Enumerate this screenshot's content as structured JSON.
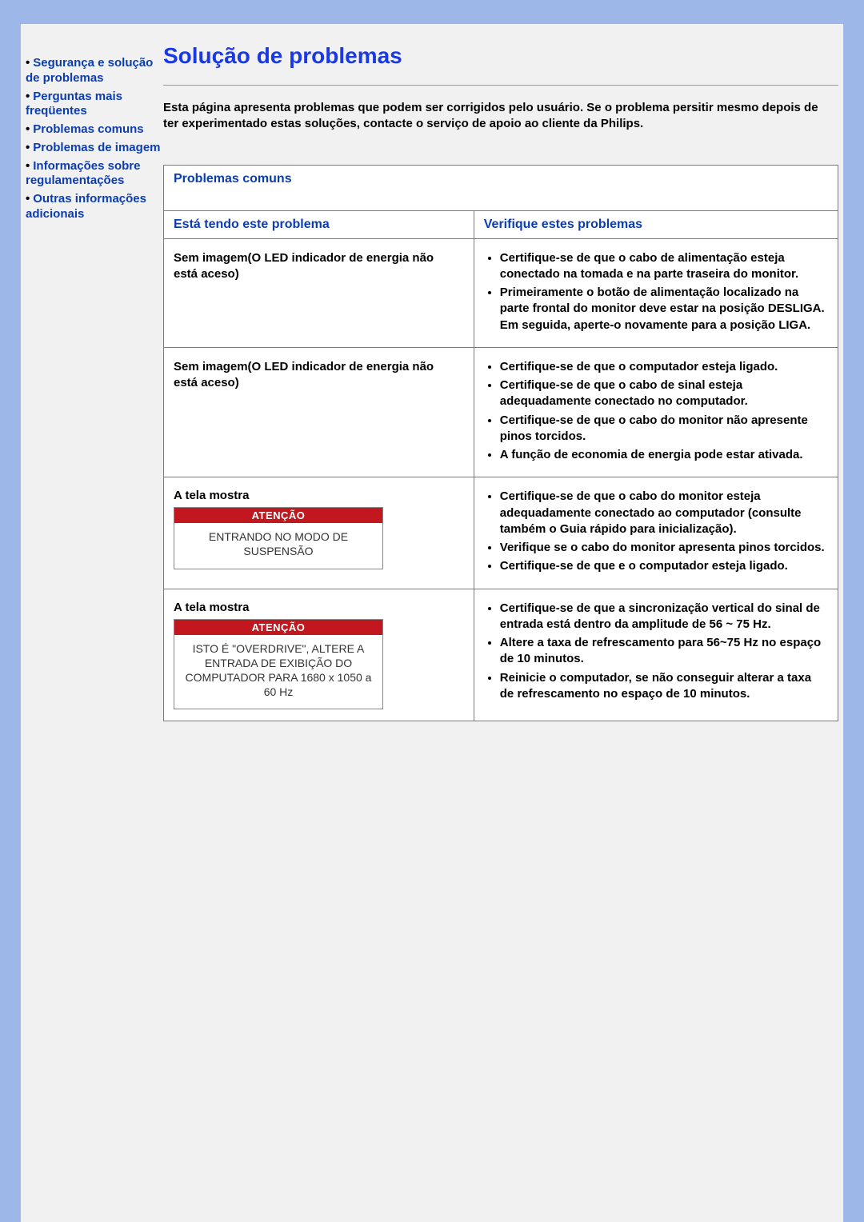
{
  "sidebar": {
    "items": [
      "Segurança e solução de problemas",
      "Perguntas mais freqüentes",
      "Problemas comuns",
      "Problemas de imagem",
      "Informações sobre regulamentações",
      "Outras informações adicionais"
    ]
  },
  "main": {
    "title": "Solução de problemas",
    "intro": "Esta página apresenta problemas que podem ser corrigidos pelo usuário. Se o problema persitir mesmo depois de ter experimentado estas soluções, contacte o serviço de apoio ao cliente da Philips."
  },
  "table": {
    "caption": "Problemas comuns",
    "head_problem": "Está tendo este problema",
    "head_check": "Verifique estes problemas",
    "rows": [
      {
        "problem_lines": [
          "Sem imagem(O LED indicador de energia não",
          "está aceso)"
        ],
        "checks": [
          "Certifique-se de que o cabo de alimentação esteja conectado na tomada e na parte traseira do monitor.",
          "Primeiramente o botão de alimentação localizado na parte frontal do monitor deve estar na posição DESLIGA. Em seguida, aperte-o novamente para a posição LIGA."
        ]
      },
      {
        "problem_lines": [
          "Sem imagem(O LED indicador de energia não",
          "está aceso)"
        ],
        "checks": [
          "Certifique-se de que o computador esteja ligado.",
          "Certifique-se de que o cabo de sinal esteja adequadamente conectado no computador.",
          "Certifique-se de que o cabo do monitor não apresente pinos torcidos.",
          "A função de economia de energia pode estar ativada."
        ]
      },
      {
        "show_label": "A tela mostra",
        "warn_title": "ATENÇÃO",
        "warn_body": "ENTRANDO NO MODO DE SUSPENSÃO",
        "checks": [
          "Certifique-se de que o cabo do monitor esteja adequadamente conectado ao computador (consulte também o Guia rápido para inicialização).",
          "Verifique se o cabo do monitor apresenta pinos torcidos.",
          "Certifique-se de que e o computador esteja ligado."
        ]
      },
      {
        "show_label": "A tela mostra",
        "warn_title": "ATENÇÃO",
        "warn_body": "ISTO É \"OVERDRIVE\", ALTERE A ENTRADA DE EXIBIÇÃO DO COMPUTADOR PARA 1680 x 1050 a 60 Hz",
        "checks": [
          "Certifique-se de que a sincronização vertical do sinal de entrada está dentro da amplitude de 56 ~ 75 Hz.",
          "Altere a taxa de refrescamento para 56~75 Hz no espaço de 10 minutos.",
          "Reinicie o computador, se não conseguir alterar a taxa de refrescamento no espaço de 10 minutos."
        ]
      }
    ]
  }
}
